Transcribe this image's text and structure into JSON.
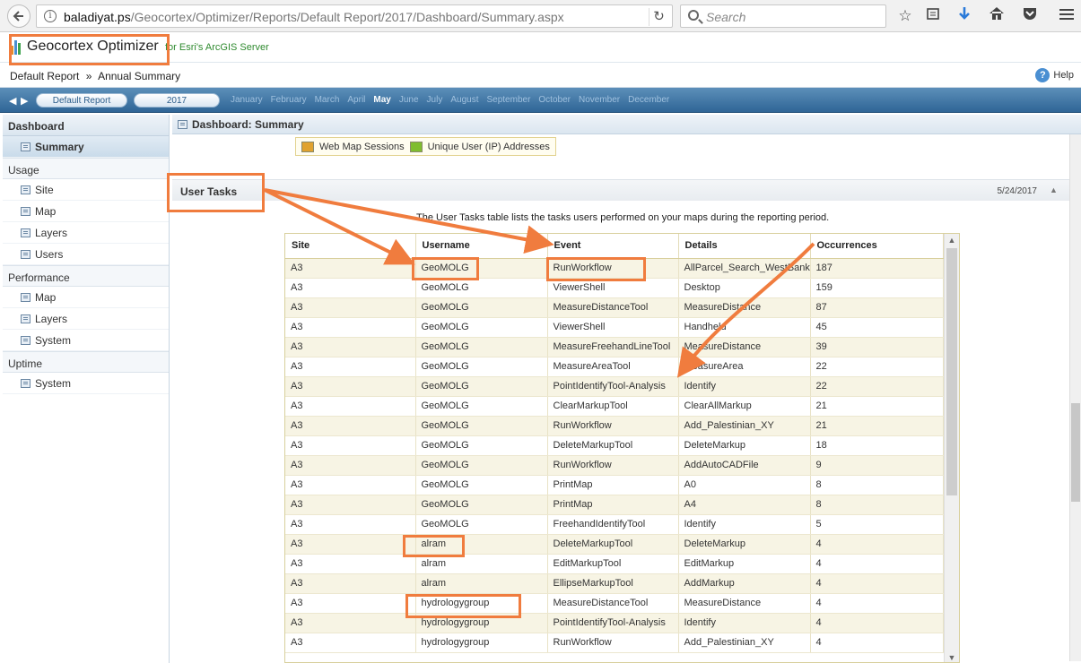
{
  "browser": {
    "url_host": "baladiyat.ps",
    "url_path": "/Geocortex/Optimizer/Reports/Default Report/2017/Dashboard/Summary.aspx",
    "search_placeholder": "Search"
  },
  "header": {
    "title": "Geocortex Optimizer",
    "subtitle": "for Esri's ArcGIS Server"
  },
  "breadcrumb": {
    "report": "Default Report",
    "separator": "»",
    "page": "Annual Summary"
  },
  "help_label": "Help",
  "period": {
    "report_pill": "Default Report",
    "year_pill": "2017",
    "months": [
      "January",
      "February",
      "March",
      "April",
      "May",
      "June",
      "July",
      "August",
      "September",
      "October",
      "November",
      "December"
    ],
    "active_month": "May"
  },
  "sidebar": {
    "dashboard": "Dashboard",
    "dashboard_items": [
      "Summary"
    ],
    "usage": "Usage",
    "usage_items": [
      "Site",
      "Map",
      "Layers",
      "Users"
    ],
    "performance": "Performance",
    "performance_items": [
      "Map",
      "Layers",
      "System"
    ],
    "uptime": "Uptime",
    "uptime_items": [
      "System"
    ]
  },
  "main": {
    "title": "Dashboard: Summary",
    "legend": [
      {
        "label": "Web Map Sessions",
        "color": "#e0a22e"
      },
      {
        "label": "Unique User (IP) Addresses",
        "color": "#7fbd2f"
      }
    ],
    "section_title": "User Tasks",
    "section_date": "5/24/2017",
    "description": "The User Tasks table lists the tasks users performed on your maps during the reporting period."
  },
  "table": {
    "headers": [
      "Site",
      "Username",
      "Event",
      "Details",
      "Occurrences"
    ],
    "rows": [
      [
        "A3",
        "GeoMOLG",
        "RunWorkflow",
        "AllParcel_Search_WestBank",
        "187"
      ],
      [
        "A3",
        "GeoMOLG",
        "ViewerShell",
        "Desktop",
        "159"
      ],
      [
        "A3",
        "GeoMOLG",
        "MeasureDistanceTool",
        "MeasureDistance",
        "87"
      ],
      [
        "A3",
        "GeoMOLG",
        "ViewerShell",
        "Handheld",
        "45"
      ],
      [
        "A3",
        "GeoMOLG",
        "MeasureFreehandLineTool",
        "MeasureDistance",
        "39"
      ],
      [
        "A3",
        "GeoMOLG",
        "MeasureAreaTool",
        "MeasureArea",
        "22"
      ],
      [
        "A3",
        "GeoMOLG",
        "PointIdentifyTool-Analysis",
        "Identify",
        "22"
      ],
      [
        "A3",
        "GeoMOLG",
        "ClearMarkupTool",
        "ClearAllMarkup",
        "21"
      ],
      [
        "A3",
        "GeoMOLG",
        "RunWorkflow",
        "Add_Palestinian_XY",
        "21"
      ],
      [
        "A3",
        "GeoMOLG",
        "DeleteMarkupTool",
        "DeleteMarkup",
        "18"
      ],
      [
        "A3",
        "GeoMOLG",
        "RunWorkflow",
        "AddAutoCADFile",
        "9"
      ],
      [
        "A3",
        "GeoMOLG",
        "PrintMap",
        "A0",
        "8"
      ],
      [
        "A3",
        "GeoMOLG",
        "PrintMap",
        "A4",
        "8"
      ],
      [
        "A3",
        "GeoMOLG",
        "FreehandIdentifyTool",
        "Identify",
        "5"
      ],
      [
        "A3",
        "alram",
        "DeleteMarkupTool",
        "DeleteMarkup",
        "4"
      ],
      [
        "A3",
        "alram",
        "EditMarkupTool",
        "EditMarkup",
        "4"
      ],
      [
        "A3",
        "alram",
        "EllipseMarkupTool",
        "AddMarkup",
        "4"
      ],
      [
        "A3",
        "hydrologygroup",
        "MeasureDistanceTool",
        "MeasureDistance",
        "4"
      ],
      [
        "A3",
        "hydrologygroup",
        "PointIdentifyTool-Analysis",
        "Identify",
        "4"
      ],
      [
        "A3",
        "hydrologygroup",
        "RunWorkflow",
        "Add_Palestinian_XY",
        "4"
      ]
    ]
  },
  "annotation_color": "#f07c3e"
}
